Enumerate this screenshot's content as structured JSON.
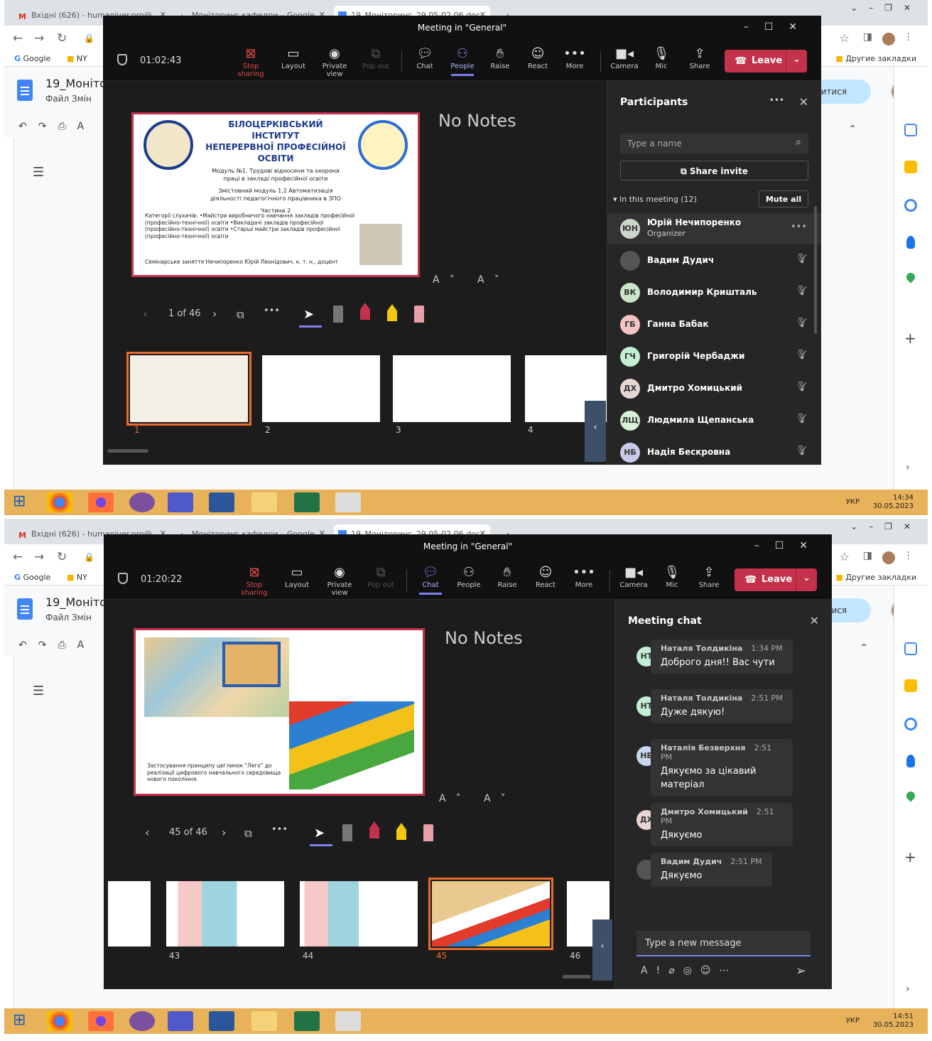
{
  "shots": [
    {
      "browser": {
        "tabs": [
          "Вхідні (626) - humaniver.pro@...",
          "Моніторинг кафедри – Google...",
          "19_Моніторинг_29.05-02.06.doc..."
        ],
        "bookmarks": [
          "Google",
          "NY"
        ],
        "other_bookmarks": "Другие закладки",
        "doc_title": "19_Моніто",
        "doc_menu": "Файл  Змін",
        "share_label": "литися"
      },
      "teams": {
        "title": "Meeting in \"General\"",
        "timer": "01:02:43",
        "toolbar": [
          "Stop sharing",
          "Layout",
          "Private view",
          "Pop out",
          "Chat",
          "People",
          "Raise",
          "React",
          "More",
          "Camera",
          "Mic",
          "Share"
        ],
        "leave": "Leave",
        "notes": "No Notes",
        "font_controls": "A˄ A˅",
        "slide_counter": "1 of 46",
        "slide": {
          "title1": "БІЛОЦЕРКІВСЬКИЙ ІНСТИТУТ",
          "title2": "НЕПЕРЕРВНОЇ ПРОФЕСІЙНОЇ ОСВІТИ",
          "module": "Модуль №1. Трудові відносини та охорона праці в закладі професійної освіти",
          "submodule": "Змістовний модуль 1.2 Автоматизація діяльності педагогічного працівника в ЗПО",
          "part": "Частина 2",
          "audience": "Категорії слухачів: •Майстри виробничого навчання закладів професійної (професійно-технічної) освіти •Викладачі закладів професійної (професійно-технічної) освіти •Старші майстри закладів професійної (професійно-технічної) освіти",
          "footer": "Семінарське заняття     Нечипоренко Юрій Леонідович, к. т. н., доцент"
        },
        "thumb_numbers": [
          "1",
          "2",
          "3",
          "4"
        ],
        "panel": {
          "title": "Participants",
          "search_placeholder": "Type a name",
          "share_invite": "Share invite",
          "in_meeting": "In this meeting (12)",
          "mute_all": "Mute all",
          "participants": [
            {
              "initials": "ЮН",
              "name": "Юрій Нечипоренко",
              "role": "Organizer",
              "color": "#c9d6c9"
            },
            {
              "initials": "",
              "name": "Вадим Дудич",
              "role": "",
              "color": "#555555"
            },
            {
              "initials": "ВК",
              "name": "Володимир Кришталь",
              "role": "",
              "color": "#c9e6c9"
            },
            {
              "initials": "ГБ",
              "name": "Ганна Бабак",
              "role": "",
              "color": "#f4c2c2"
            },
            {
              "initials": "ГЧ",
              "name": "Григорій Чербаджи",
              "role": "",
              "color": "#c2eed3"
            },
            {
              "initials": "ДХ",
              "name": "Дмитро Хомицький",
              "role": "",
              "color": "#e6d5d0"
            },
            {
              "initials": "ЛЩ",
              "name": "Людмила Щепанська",
              "role": "",
              "color": "#d6f0d6"
            },
            {
              "initials": "НБ",
              "name": "Надія Бескровна",
              "role": "",
              "color": "#c9c9e8"
            }
          ]
        }
      },
      "taskbar": {
        "lang": "УКР",
        "time": "14:34",
        "date": "30.05.2023"
      }
    },
    {
      "browser": {
        "tabs": [
          "Вхідні (626) - humaniver.pro@...",
          "Моніторинг кафедри – Google...",
          "19_Моніторинг_29.05-02.06.doc..."
        ],
        "bookmarks": [
          "Google",
          "NY"
        ],
        "other_bookmarks": "Другие закладки",
        "doc_title": "19_Моніто",
        "doc_menu": "Файл  Змін",
        "share_label": "литися"
      },
      "teams": {
        "title": "Meeting in \"General\"",
        "timer": "01:20:22",
        "toolbar": [
          "Stop sharing",
          "Layout",
          "Private view",
          "Pop out",
          "Chat",
          "People",
          "Raise",
          "React",
          "More",
          "Camera",
          "Mic",
          "Share"
        ],
        "leave": "Leave",
        "notes": "No Notes",
        "font_controls": "A˄ A˅",
        "slide_counter": "45 of 46",
        "slide": {
          "caption": "Застосування принципу цеглинок \"Лего\" до реалізації цифрового навчального середовища нового покоління."
        },
        "thumb_numbers": [
          "43",
          "44",
          "45",
          "46"
        ],
        "panel": {
          "title": "Meeting chat",
          "messages": [
            {
              "initials": "НТ",
              "author": "Наталя Толдикіна",
              "time": "1:34 PM",
              "text": "Доброго дня!! Вас чути",
              "color": "#c2eed3",
              "status": "#c4314b"
            },
            {
              "initials": "НТ",
              "author": "Наталя Толдикіна",
              "time": "2:51 PM",
              "text": "Дуже дякую!",
              "color": "#c2eed3",
              "status": "#c4314b"
            },
            {
              "initials": "НБ",
              "author": "Наталія Безверхня",
              "time": "2:51 PM",
              "text": "Дякуємо за цікавий матеріал",
              "color": "#c9d6f0",
              "status": "#6bb700"
            },
            {
              "initials": "ДХ",
              "author": "Дмитро Хомицький",
              "time": "2:51 PM",
              "text": "Дякуємо",
              "color": "#e6d5d0",
              "status": "#c4314b"
            },
            {
              "initials": "",
              "author": "Вадим Дудич",
              "time": "2:51 PM",
              "text": "Дякуємо",
              "color": "#555555",
              "status": "#c4314b"
            }
          ],
          "compose_placeholder": "Type a new message"
        }
      },
      "taskbar": {
        "lang": "УКР",
        "time": "14:51",
        "date": "30.05.2023"
      }
    }
  ]
}
